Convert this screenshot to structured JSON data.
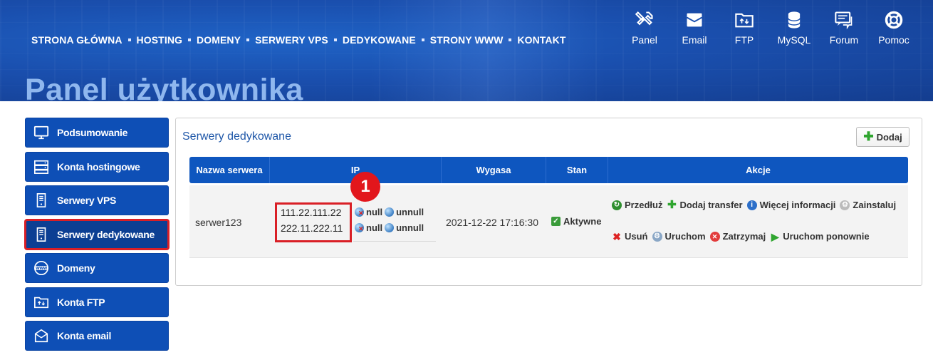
{
  "topnav": [
    "STRONA GŁÓWNA",
    "HOSTING",
    "DOMENY",
    "SERWERY VPS",
    "DEDYKOWANE",
    "STRONY WWW",
    "KONTAKT"
  ],
  "tools": [
    {
      "label": "Panel",
      "icon": "tools-icon"
    },
    {
      "label": "Email",
      "icon": "email-icon"
    },
    {
      "label": "FTP",
      "icon": "ftp-folder-icon"
    },
    {
      "label": "MySQL",
      "icon": "database-icon"
    },
    {
      "label": "Forum",
      "icon": "forum-icon"
    },
    {
      "label": "Pomoc",
      "icon": "lifebuoy-icon"
    }
  ],
  "page_title": "Panel użytkownika",
  "sidebar": [
    {
      "label": "Podsumowanie",
      "icon": "monitor-icon"
    },
    {
      "label": "Konta hostingowe",
      "icon": "server-stack-icon"
    },
    {
      "label": "Serwery VPS",
      "icon": "server-icon"
    },
    {
      "label": "Serwery dedykowane",
      "icon": "server-icon",
      "active": true
    },
    {
      "label": "Domeny",
      "icon": "www-globe-icon"
    },
    {
      "label": "Konta FTP",
      "icon": "ftp-folder-icon"
    },
    {
      "label": "Konta email",
      "icon": "email-icon"
    }
  ],
  "main": {
    "title": "Serwery dedykowane",
    "add_label": "Dodaj",
    "columns": [
      "Nazwa serwera",
      "IP",
      "Wygasa",
      "Stan",
      "Akcje"
    ],
    "row": {
      "name": "serwer123",
      "ips": [
        "111.22.111.22",
        "222.11.222.11"
      ],
      "ip_action_null": "null",
      "ip_action_unnull": "unnull",
      "expires": "2021-12-22 17:16:30",
      "status": "Aktywne",
      "actions_row1": [
        "Przedłuż",
        "Dodaj transfer",
        "Więcej informacji",
        "Zainstaluj"
      ],
      "actions_row2": [
        "Usuń",
        "Uruchom",
        "Zatrzymaj",
        "Uruchom ponownie"
      ]
    }
  },
  "annotation_badge": "1",
  "colors": {
    "brand_blue": "#0e4fb6",
    "highlight_red": "#d91f26"
  }
}
